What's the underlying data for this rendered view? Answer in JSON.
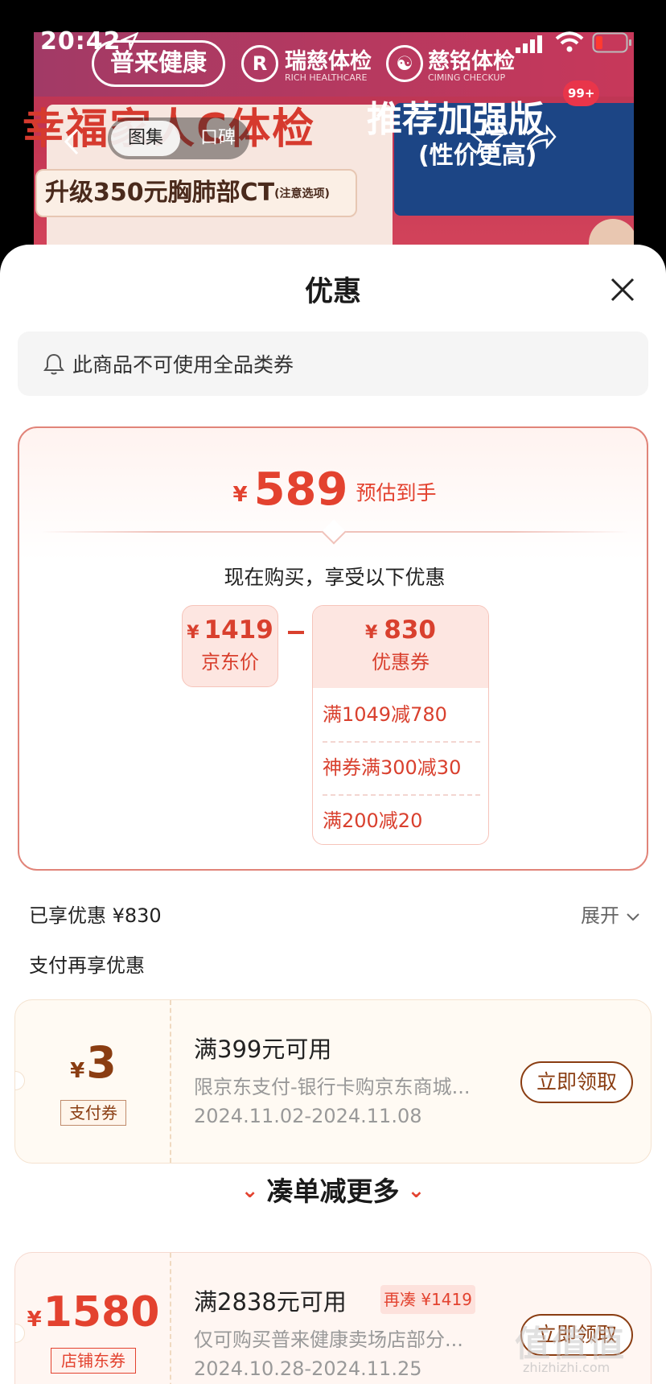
{
  "status_bar": {
    "time": "20:42"
  },
  "banner": {
    "brand1": "普来健康",
    "brand2_logo": "R",
    "brand2": "瑞慈体检",
    "brand2_sub": "RICH HEALTHCARE",
    "brand3": "慈铭体检",
    "brand3_sub": "CIMING CHECKUP",
    "poster_title": "幸福家人C体检",
    "poster_sub": "升级350元胸肺部CT",
    "poster_sub_note": "(注意选项)",
    "promo_title": "推荐加强版",
    "promo_sub": "(性价更高)",
    "badge": "99+"
  },
  "nav": {
    "tab_gallery": "图集",
    "tab_reviews": "口碑"
  },
  "sheet": {
    "title": "优惠",
    "notice": "此商品不可使用全品类券"
  },
  "calc": {
    "currency": "¥",
    "final_price": "589",
    "final_tag": "预估到手",
    "buy_now": "现在购买，享受以下优惠",
    "jd_price": "1419",
    "jd_label": "京东价",
    "coupon_total": "830",
    "coupon_label": "优惠券",
    "coupon_items": [
      "满1049减780",
      "神券满300减30",
      "满200减20"
    ]
  },
  "summary": {
    "enjoyed": "已享优惠 ¥830",
    "expand": "展开",
    "pay_more": "支付再享优惠"
  },
  "pay_coupon": {
    "currency": "¥",
    "amount": "3",
    "tag": "支付券",
    "title": "满399元可用",
    "desc": "限京东支付-银行卡购京东商城...",
    "date": "2024.11.02-2024.11.08",
    "button": "立即领取"
  },
  "combine": {
    "title": "凑单减更多"
  },
  "shop_coupon": {
    "currency": "¥",
    "amount": "1580",
    "tag": "店铺东券",
    "title": "满2838元可用",
    "addon": "再凑 ¥1419",
    "desc": "仅可购买普来健康卖场店部分...",
    "date": "2024.10.28-2024.11.25",
    "button": "立即领取"
  },
  "watermark": {
    "logo": "值值值",
    "url": "zhizhizhi.com"
  },
  "colors": {
    "accent": "#e3422f",
    "brown": "#8a3d12",
    "border": "#e18479"
  }
}
